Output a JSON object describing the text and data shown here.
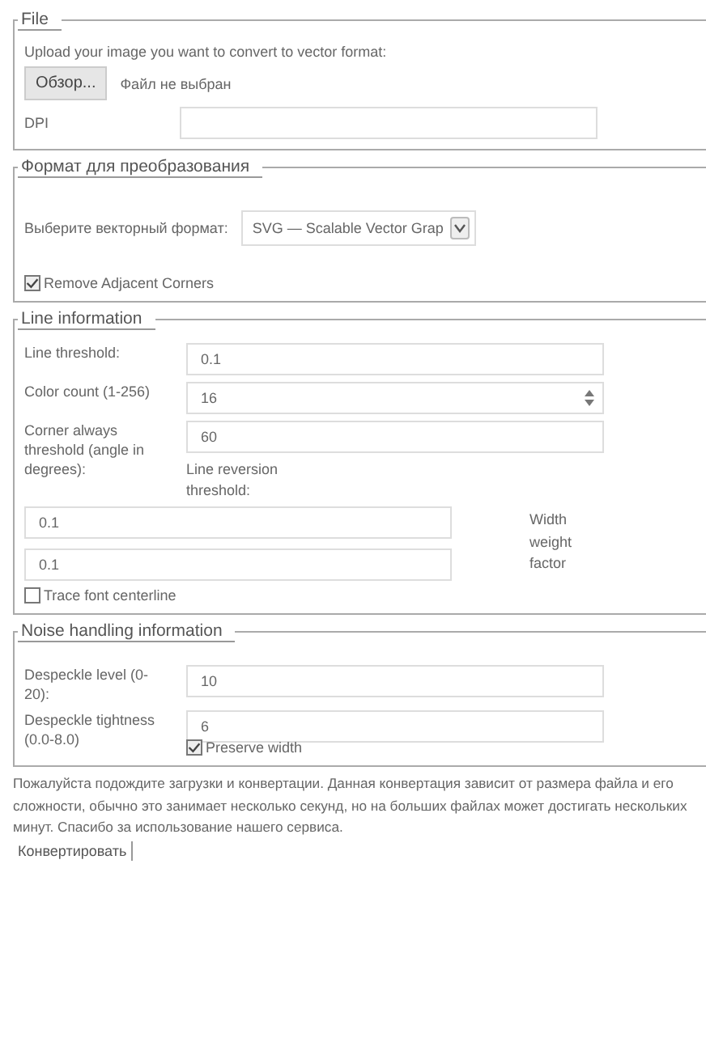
{
  "file_section": {
    "legend": "File",
    "prompt": "Upload your image you want to convert to vector format:",
    "browse_button": "Обзор...",
    "file_status": "Файл не выбран",
    "dpi_label": "DPI"
  },
  "format_section": {
    "legend": "Формат для преобразования",
    "select_label": "Выберите векторный формат:",
    "select_value": "SVG — Scalable Vector Grap",
    "remove_corners": {
      "label": "Remove Adjacent Corners",
      "checked": true
    }
  },
  "line_section": {
    "legend": "Line information",
    "fields": [
      {
        "label": "Line threshold:",
        "value": "0.1",
        "kind": "text"
      },
      {
        "label": "Color count (1-256)",
        "value": "16",
        "kind": "number"
      },
      {
        "label": "Corner always threshold (angle in degrees):",
        "value": "60",
        "kind": "text"
      }
    ],
    "reversion_label": "Line reversion threshold:",
    "reversion_value": "0.1",
    "width_weight_label": "Width weight factor",
    "width_weight_value": "0.1",
    "trace_centerline": {
      "label": "Trace font centerline",
      "checked": false
    }
  },
  "noise_section": {
    "legend": "Noise handling information",
    "fields": [
      {
        "label": "Despeckle level (0-20):",
        "value": "10"
      },
      {
        "label": "Despeckle tightness (0.0-8.0)",
        "value": "6"
      }
    ],
    "preserve_width": {
      "label": "Preserve width",
      "checked": true
    }
  },
  "notice": "Пожалуйста подождите загрузки и конвертации. Данная конвертация зависит от размера файла и его сложности, обычно это занимает несколько секунд, но на больших файлах может достигать нескольких минут. Спасибо за использование нашего сервиса.",
  "convert_button": "Конвертировать"
}
